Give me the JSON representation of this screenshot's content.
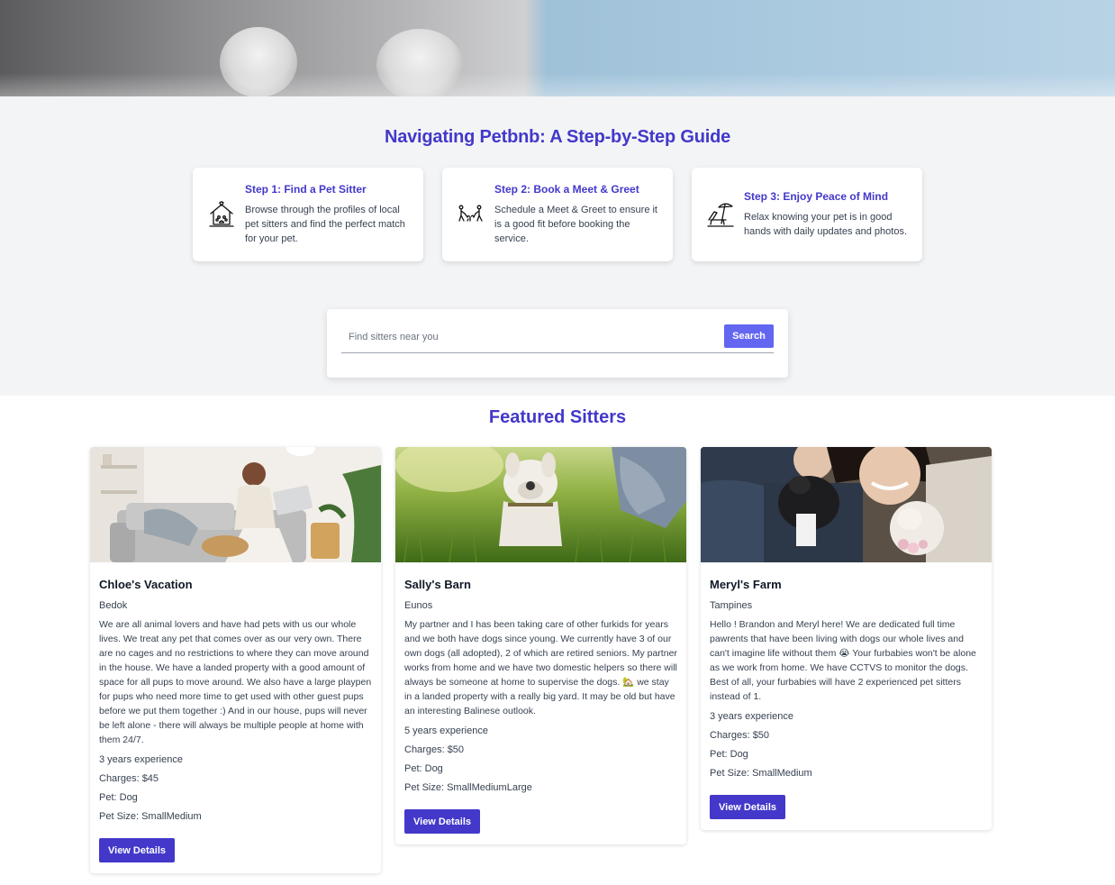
{
  "guide": {
    "title": "Navigating Petbnb: A Step-by-Step Guide",
    "steps": [
      {
        "icon": "pet-house-icon",
        "title": "Step 1: Find a Pet Sitter",
        "desc": "Browse through the profiles of local pet sitters and find the perfect match for your pet."
      },
      {
        "icon": "walking-dogs-icon",
        "title": "Step 2: Book a Meet & Greet",
        "desc": "Schedule a Meet & Greet to ensure it is a good fit before booking the service."
      },
      {
        "icon": "beach-chair-icon",
        "title": "Step 3: Enjoy Peace of Mind",
        "desc": "Relax knowing your pet is in good hands with daily updates and photos."
      }
    ]
  },
  "search": {
    "placeholder": "Find sitters near you",
    "button_label": "Search"
  },
  "featured": {
    "title": "Featured Sitters",
    "sitters": [
      {
        "name": "Chloe's Vacation",
        "location": "Bedok",
        "description": "We are all animal lovers and have had pets with us our whole lives. We treat any pet that comes over as our very own. There are no cages and no restrictions to where they can move around in the house. We have a landed property with a good amount of space for all pups to move around. We also have a large playpen for pups who need more time to get used with other guest pups before we put them together :) And in our house, pups will never be left alone - there will always be multiple people at home with them 24/7.",
        "experience": "3 years experience",
        "charges": "Charges: $45",
        "pet": "Pet: Dog",
        "pet_size": "Pet Size: SmallMedium",
        "button_label": "View Details"
      },
      {
        "name": "Sally's Barn",
        "location": "Eunos",
        "description": "My partner and I has been taking care of other furkids for years and we both have dogs since young. We currently have 3 of our own dogs (all adopted), 2 of which are retired seniors. My partner works from home and we have two domestic helpers so there will always be someone at home to supervise the dogs. 🏡 we stay in a landed property with a really big yard. It may be old but have an interesting Balinese outlook.",
        "experience": "5 years experience",
        "charges": "Charges: $50",
        "pet": "Pet: Dog",
        "pet_size": "Pet Size: SmallMediumLarge",
        "button_label": "View Details"
      },
      {
        "name": "Meryl's Farm",
        "location": "Tampines",
        "description": "Hello ! Brandon and Meryl here! We are dedicated full time pawrents that have been living with dogs our whole lives and can't imagine life without them 😭 Your furbabies won't be alone as we work from home. We have CCTVS to monitor the dogs. Best of all, your furbabies will have 2 experienced pet sitters instead of 1.",
        "experience": "3 years experience",
        "charges": "Charges: $50",
        "pet": "Pet: Dog",
        "pet_size": "Pet Size: SmallMedium",
        "button_label": "View Details"
      }
    ]
  }
}
